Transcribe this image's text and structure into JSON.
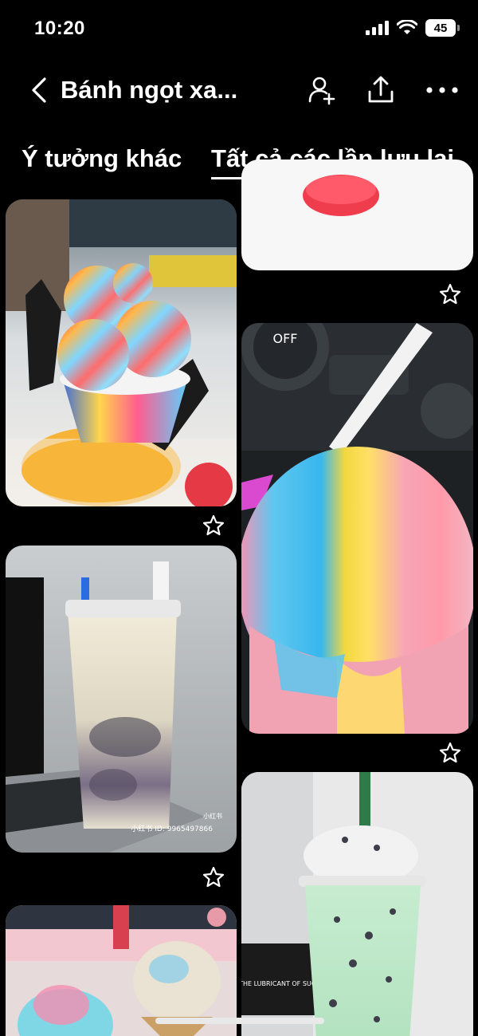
{
  "status_bar": {
    "time": "10:20",
    "battery": "45",
    "icons": [
      "cellular-signal-icon",
      "wifi-icon",
      "battery-icon"
    ]
  },
  "header": {
    "title": "Bánh ngọt xa...",
    "back_icon": "chevron-left-icon",
    "actions": [
      "add-collaborator-icon",
      "share-icon",
      "more-icon"
    ]
  },
  "tabs": [
    {
      "label": "Ý tưởng khác",
      "active": false
    },
    {
      "label": "Tất cả các lần lưu lại",
      "active": true
    }
  ],
  "pins": {
    "left": [
      {
        "label": "",
        "icon": "star-outline-icon"
      },
      {
        "label": "小红书 ID: 9965497866",
        "watermark": "小红书",
        "icon": "star-outline-icon"
      },
      {
        "label": ""
      }
    ],
    "right": [
      {
        "label": "",
        "icon": "star-outline-icon"
      },
      {
        "label": "OFF",
        "icon": "star-outline-icon"
      },
      {
        "label": "THE LUBRICANT OF SUCC"
      }
    ]
  },
  "colors": {
    "background": "#000000",
    "text": "#ffffff"
  }
}
